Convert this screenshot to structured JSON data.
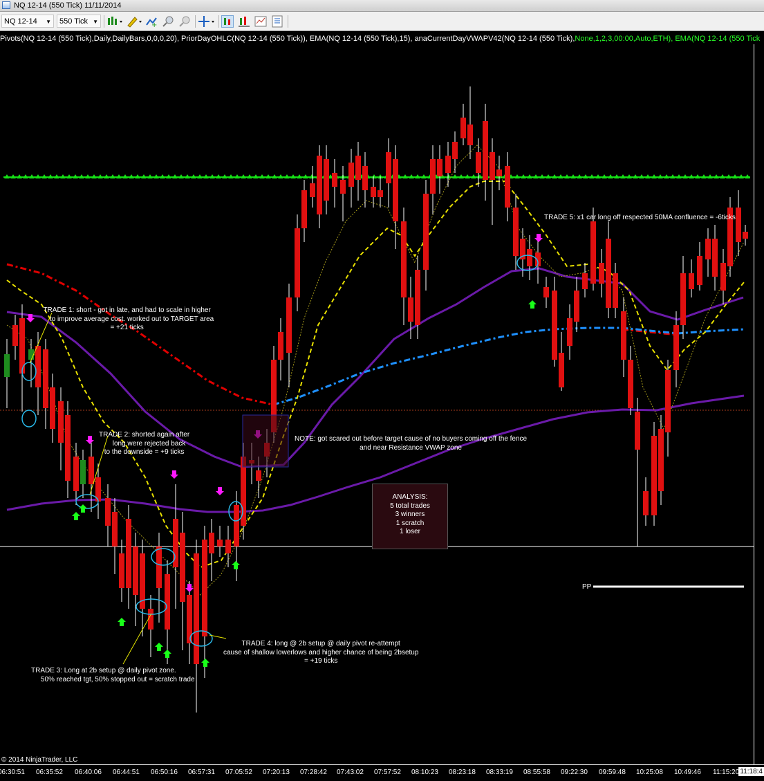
{
  "window": {
    "title": "NQ 12-14 (550 Tick)  11/11/2014"
  },
  "toolbar": {
    "instrument": "NQ 12-14",
    "interval": "550 Tick",
    "icons": [
      "bar-type-icon",
      "draw-pencil-icon",
      "add-indicator-icon",
      "zoom-in-icon",
      "zoom-out-icon",
      "crosshair-icon",
      "chart-trader-icon",
      "data-box-icon",
      "properties-icon"
    ]
  },
  "indicator_line": {
    "white_text": "Pivots(NQ 12-14 (550 Tick),Daily,DailyBars,0,0,0,20), PriorDayOHLC(NQ 12-14 (550 Tick)), EMA(NQ 12-14 (550 Tick),15), anaCurrentDayVWAPV42(NQ 12-14 (550 Tick),",
    "green_text": "None,1,2,3,00:00,Auto,ETH), EMA(NQ 12-14 (550 Tick"
  },
  "annotations": {
    "trade1": "TRADE 1: short - got in late, and had to scale in higher\n     to improve average cost. worked out to TARGET area\n= +21 ticks",
    "trade2": "TRADE 2: shorted again after\n     long were rejected back\nto the downside = +9 ticks",
    "trade3": "TRADE 3: Long at 2b setup @ daily pivot zone.\n     50% reached tgt, 50% stopped out = scratch trade",
    "trade4": "TRADE 4: long @ 2b setup @ daily pivot re-attempt\ncause of shallow lowerlows and higher chance of being 2bsetup\n= +19 ticks",
    "trade5": "TRADE 5: x1 car long off respected 50MA confluence = -6ticks",
    "note": "NOTE: got scared out before target cause of no buyers coming off the fence\nand near Resistance VWAP zone",
    "analysis": "ANALYSIS:\n5 total trades\n3 winners\n1 scratch\n1 loser",
    "pp_label": "PP",
    "copyright": "© 2014 NinjaTrader, LLC"
  },
  "x_axis": {
    "labels": [
      "06:30:51",
      "06:35:52",
      "06:40:06",
      "06:44:51",
      "06:50:16",
      "06:57:31",
      "07:05:52",
      "07:20:13",
      "07:28:42",
      "07:43:02",
      "07:57:52",
      "08:10:23",
      "08:23:18",
      "08:33:19",
      "08:55:58",
      "09:22:30",
      "09:59:48",
      "10:25:08",
      "10:49:46",
      "11:15:20"
    ],
    "last_label": "11:18:4"
  },
  "colors": {
    "up_candle": "#1e8c1e",
    "down_candle": "#e01010",
    "ema15": "#e8e000",
    "vwap_band": "#6a1aa8",
    "vwap_blue": "#1e90ff",
    "prior_day_red": "#e00000",
    "pivot_green": "#16e016",
    "buy_arrow": "#19ff19",
    "sell_arrow": "#ff19ff"
  },
  "chart_data": {
    "type": "candlestick",
    "instrument": "NQ 12-14",
    "interval": "550 Tick",
    "x": [
      "06:30:51",
      "06:35:52",
      "06:40:06",
      "06:44:51",
      "06:50:16",
      "06:57:31",
      "07:05:52",
      "07:20:13",
      "07:28:42",
      "07:43:02",
      "07:57:52",
      "08:10:23",
      "08:23:18",
      "08:33:19",
      "08:55:58",
      "09:22:30",
      "09:59:48",
      "10:25:08",
      "10:49:46",
      "11:15:20"
    ],
    "legend": [
      "Pivots(NQ 12-14 (550 Tick),Daily,DailyBars,0,0,0,20)",
      "PriorDayOHLC(NQ 12-14 (550 Tick))",
      "EMA(NQ 12-14 (550 Tick),15)",
      "anaCurrentDayVWAPV42(NQ 12-14 (550 Tick),None,1,2,3,00:00,Auto,ETH)",
      "EMA(NQ 12-14 (550 Tick"
    ],
    "levels": [
      "PP"
    ]
  }
}
